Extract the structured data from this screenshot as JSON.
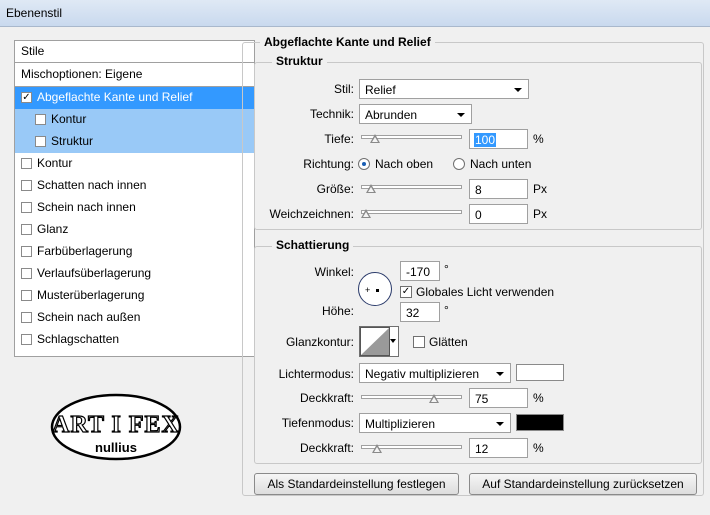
{
  "window": {
    "title": "Ebenenstil"
  },
  "style_list": {
    "header": "Stile",
    "mix": "Mischoptionen: Eigene",
    "items": [
      {
        "label": "Abgeflachte Kante und Relief",
        "checked": true,
        "state": "active"
      },
      {
        "label": "Kontur",
        "checked": false,
        "state": "sub"
      },
      {
        "label": "Struktur",
        "checked": false,
        "state": "sub"
      },
      {
        "label": "Kontur",
        "checked": false
      },
      {
        "label": "Schatten nach innen",
        "checked": false
      },
      {
        "label": "Schein nach innen",
        "checked": false
      },
      {
        "label": "Glanz",
        "checked": false
      },
      {
        "label": "Farbüberlagerung",
        "checked": false
      },
      {
        "label": "Verlaufsüberlagerung",
        "checked": false
      },
      {
        "label": "Musterüberlagerung",
        "checked": false
      },
      {
        "label": "Schein nach außen",
        "checked": false
      },
      {
        "label": "Schlagschatten",
        "checked": false
      }
    ],
    "check_mark": "✓"
  },
  "logo": {
    "top": "ART I FEX",
    "bottom": "nullius"
  },
  "panel": {
    "title": "Abgeflachte Kante und Relief",
    "structure": {
      "title": "Struktur",
      "style_label": "Stil:",
      "style_value": "Relief",
      "technique_label": "Technik:",
      "technique_value": "Abrunden",
      "depth_label": "Tiefe:",
      "depth_value": "100",
      "depth_unit": "%",
      "depth_level": 0.1,
      "direction_label": "Richtung:",
      "dir_up": "Nach oben",
      "dir_down": "Nach unten",
      "size_label": "Größe:",
      "size_value": "8",
      "size_unit": "Px",
      "size_level": 0.05,
      "soften_label": "Weichzeichnen:",
      "soften_value": "0",
      "soften_unit": "Px",
      "soften_level": 0.0
    },
    "shading": {
      "title": "Schattierung",
      "angle_label": "Winkel:",
      "angle_value": "-170",
      "angle_unit": "°",
      "global_light": "Globales Licht verwenden",
      "altitude_label": "Höhe:",
      "altitude_value": "32",
      "altitude_unit": "°",
      "gloss_label": "Glanzkontur:",
      "smooth": "Glätten",
      "highlight_label": "Lichtermodus:",
      "highlight_mode": "Negativ multiplizieren",
      "highlight_color": "#ffffff",
      "opacity_label": "Deckkraft:",
      "highlight_opacity": "75",
      "highlight_unit": "%",
      "highlight_level": 0.75,
      "shadow_label": "Tiefenmodus:",
      "shadow_mode": "Multiplizieren",
      "shadow_color": "#000000",
      "opacity2_label": "Deckkraft:",
      "shadow_opacity": "12",
      "shadow_unit": "%",
      "shadow_level": 0.12
    },
    "buttons": {
      "make_default": "Als Standardeinstellung festlegen",
      "reset_default": "Auf Standardeinstellung zurücksetzen"
    }
  }
}
